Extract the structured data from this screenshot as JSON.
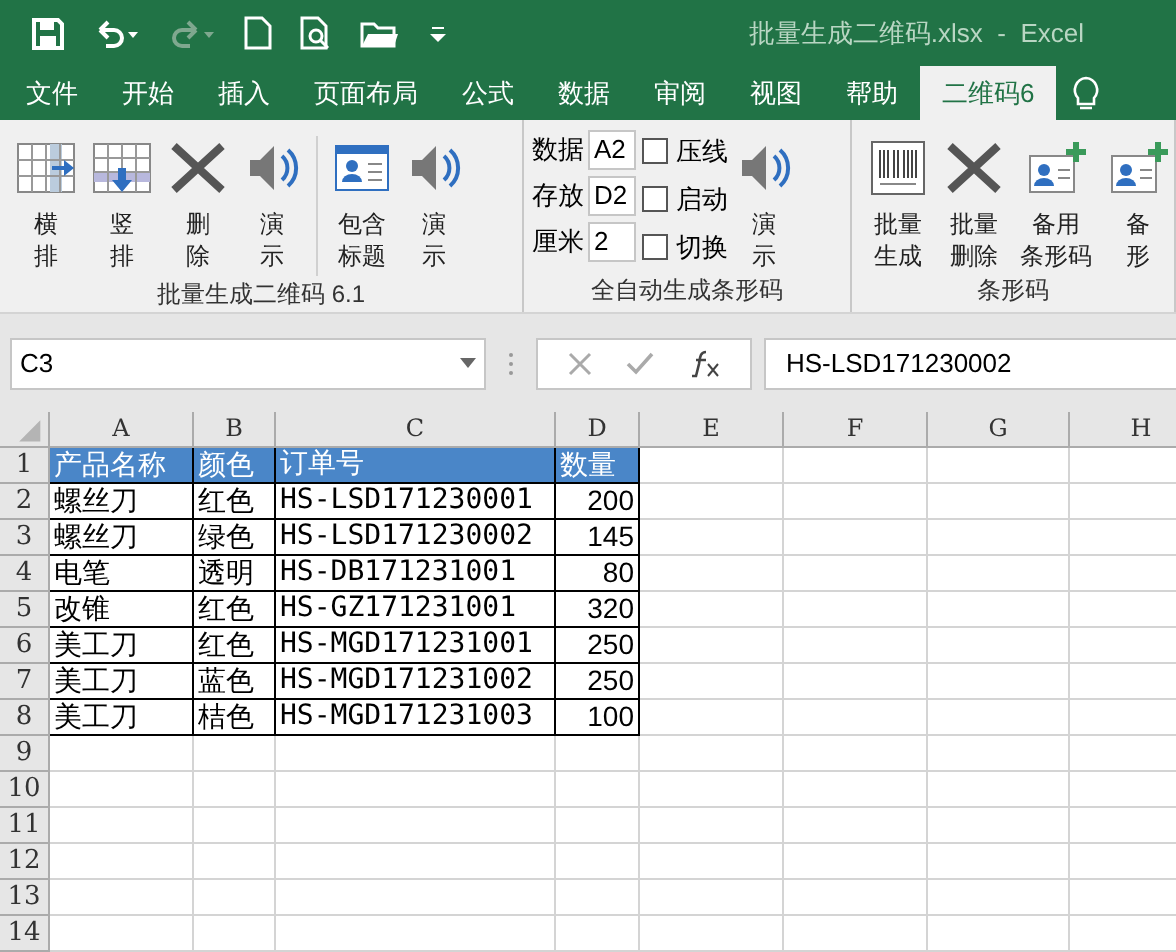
{
  "title_bar": {
    "title": "批量生成二维码.xlsx  -  Excel"
  },
  "tabs": [
    {
      "label": "文件",
      "selected": false
    },
    {
      "label": "开始",
      "selected": false
    },
    {
      "label": "插入",
      "selected": false
    },
    {
      "label": "页面布局",
      "selected": false
    },
    {
      "label": "公式",
      "selected": false
    },
    {
      "label": "数据",
      "selected": false
    },
    {
      "label": "审阅",
      "selected": false
    },
    {
      "label": "视图",
      "selected": false
    },
    {
      "label": "帮助",
      "selected": false
    },
    {
      "label": "二维码6",
      "selected": true
    }
  ],
  "ribbon": {
    "groups": [
      {
        "label": "批量生成二维码 6.1",
        "buttons": [
          {
            "kind": "horizontal",
            "lines": [
              "横",
              "排"
            ]
          },
          {
            "kind": "vertical",
            "lines": [
              "竖",
              "排"
            ]
          },
          {
            "kind": "delete",
            "lines": [
              "删",
              "除"
            ]
          },
          {
            "kind": "speaker",
            "lines": [
              "演",
              "示"
            ]
          },
          {
            "kind": "separator"
          },
          {
            "kind": "card",
            "lines": [
              "包含",
              "标题"
            ]
          },
          {
            "kind": "speaker",
            "lines": [
              "演",
              "示"
            ]
          }
        ]
      },
      {
        "label": "全自动生成条形码",
        "fields": [
          {
            "label": "数据",
            "value": "A2"
          },
          {
            "label": "存放",
            "value": "D2"
          },
          {
            "label": "厘米",
            "value": "2"
          }
        ],
        "checkboxes": [
          {
            "label": "压线",
            "checked": false
          },
          {
            "label": "启动",
            "checked": false
          },
          {
            "label": "切换",
            "checked": false
          }
        ],
        "buttons": [
          {
            "kind": "speaker",
            "lines": [
              "演",
              "示"
            ]
          }
        ]
      },
      {
        "label": "条形码",
        "buttons": [
          {
            "kind": "barcode",
            "lines": [
              "批量",
              "生成"
            ]
          },
          {
            "kind": "delete",
            "lines": [
              "批量",
              "删除"
            ]
          },
          {
            "kind": "card-plus",
            "lines": [
              "备用",
              "条形码"
            ]
          },
          {
            "kind": "card-plus",
            "lines": [
              "备",
              "形"
            ]
          }
        ]
      }
    ]
  },
  "formula_bar": {
    "name_box": "C3",
    "formula": "HS-LSD171230002"
  },
  "sheet": {
    "columns": [
      "A",
      "B",
      "C",
      "D",
      "E",
      "F",
      "G",
      "H"
    ],
    "rows": [
      {
        "number": "1",
        "header": true,
        "cells": [
          "产品名称",
          "颜色",
          "订单号",
          "数量"
        ]
      },
      {
        "number": "2",
        "header": false,
        "cells": [
          "螺丝刀",
          "红色",
          "HS-LSD171230001",
          "200"
        ]
      },
      {
        "number": "3",
        "header": false,
        "cells": [
          "螺丝刀",
          "绿色",
          "HS-LSD171230002",
          "145"
        ]
      },
      {
        "number": "4",
        "header": false,
        "cells": [
          "电笔",
          "透明",
          "HS-DB171231001",
          "80"
        ]
      },
      {
        "number": "5",
        "header": false,
        "cells": [
          "改锥",
          "红色",
          "HS-GZ171231001",
          "320"
        ]
      },
      {
        "number": "6",
        "header": false,
        "cells": [
          "美工刀",
          "红色",
          "HS-MGD171231001",
          "250"
        ]
      },
      {
        "number": "7",
        "header": false,
        "cells": [
          "美工刀",
          "蓝色",
          "HS-MGD171231002",
          "250"
        ]
      },
      {
        "number": "8",
        "header": false,
        "cells": [
          "美工刀",
          "桔色",
          "HS-MGD171231003",
          "100"
        ]
      },
      {
        "number": "9",
        "header": false,
        "cells": []
      },
      {
        "number": "10",
        "header": false,
        "cells": []
      },
      {
        "number": "11",
        "header": false,
        "cells": []
      },
      {
        "number": "12",
        "header": false,
        "cells": []
      },
      {
        "number": "13",
        "header": false,
        "cells": []
      },
      {
        "number": "14",
        "header": false,
        "cells": []
      }
    ]
  }
}
